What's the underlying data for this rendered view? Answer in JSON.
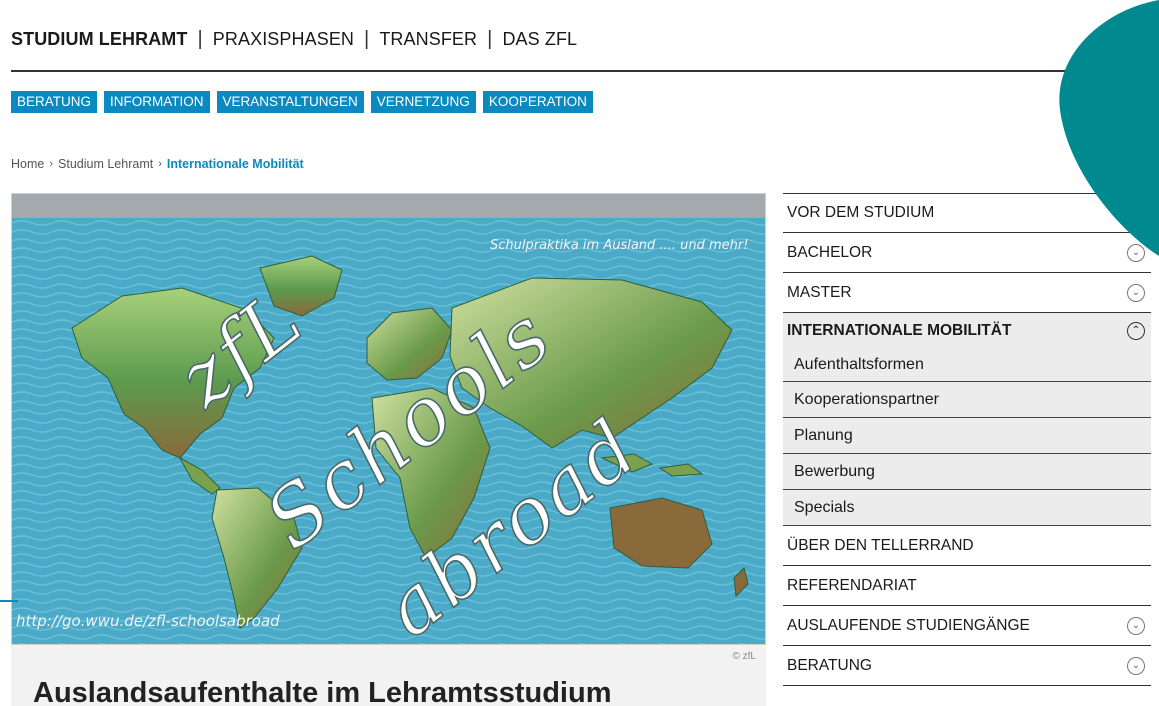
{
  "top_nav": {
    "items": [
      {
        "label": "STUDIUM LEHRAMT",
        "active": true
      },
      {
        "label": "PRAXISPHASEN",
        "active": false
      },
      {
        "label": "TRANSFER",
        "active": false
      },
      {
        "label": "DAS ZFL",
        "active": false
      }
    ],
    "separator": "|"
  },
  "sub_nav": {
    "items": [
      "BERATUNG",
      "INFORMATION",
      "VERANSTALTUNGEN",
      "VERNETZUNG",
      "KOOPERATION"
    ],
    "color": "#0a8ac0"
  },
  "breadcrumb": {
    "items": [
      "Home",
      "Studium Lehramt",
      "Internationale Mobilität"
    ],
    "separator": "›"
  },
  "hero": {
    "caption": "Schulpraktika im Ausland .... und mehr!",
    "url_text": "http://go.wwu.de/zfl-schoolsabroad",
    "big_text": [
      "zfL",
      "Schools",
      "abroad"
    ],
    "credit": "© zfL"
  },
  "article": {
    "title": "Auslandsaufenthalte im Lehramtsstudium"
  },
  "side_menu": {
    "items": [
      {
        "label": "VOR DEM STUDIUM",
        "toggle": null
      },
      {
        "label": "BACHELOR",
        "toggle": "chevron-down"
      },
      {
        "label": "MASTER",
        "toggle": "chevron-down"
      },
      {
        "label": "INTERNATIONALE MOBILITÄT",
        "toggle": "chevron-up",
        "active": true
      },
      {
        "label": "ÜBER DEN TELLERRAND",
        "toggle": null
      },
      {
        "label": "REFERENDARIAT",
        "toggle": null
      },
      {
        "label": "AUSLAUFENDE STUDIENGÄNGE",
        "toggle": "chevron-down"
      },
      {
        "label": "BERATUNG",
        "toggle": "chevron-down"
      }
    ],
    "subitems": [
      "Aufenthaltsformen",
      "Kooperationspartner",
      "Planung",
      "Bewerbung",
      "Specials"
    ]
  },
  "colors": {
    "accent_blue": "#0a8ac0",
    "teal": "#00898f",
    "ocean": "#4aaac8",
    "land_green": "#5c9b4e"
  }
}
